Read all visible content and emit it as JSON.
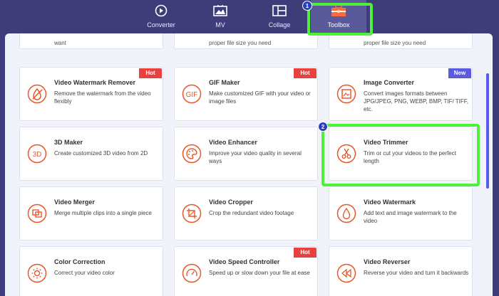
{
  "nav": {
    "tabs": [
      {
        "label": "Converter",
        "icon": "converter-icon"
      },
      {
        "label": "MV",
        "icon": "mv-icon"
      },
      {
        "label": "Collage",
        "icon": "collage-icon"
      },
      {
        "label": "Toolbox",
        "icon": "toolbox-icon"
      }
    ]
  },
  "colors": {
    "accent": "#e8572a",
    "hot": "#e8413e",
    "new": "#5b5be2",
    "highlight": "#4ef03a",
    "header": "#3e3d7a"
  },
  "partial_row": [
    "want",
    "proper file size you need",
    "proper file size you need"
  ],
  "cards": [
    {
      "title": "Video Watermark Remover",
      "desc": "Remove the watermark from the video flexibly",
      "badge": "Hot",
      "icon": "watermark-remove-icon"
    },
    {
      "title": "GIF Maker",
      "desc": "Make customized GIF with your video or image files",
      "badge": "Hot",
      "icon": "gif-icon"
    },
    {
      "title": "Image Converter",
      "desc": "Convert images formats between JPG/JPEG, PNG, WEBP, BMP, TIF/ TIFF, etc.",
      "badge": "New",
      "icon": "image-convert-icon"
    },
    {
      "title": "3D Maker",
      "desc": "Create customized 3D video from 2D",
      "badge": "",
      "icon": "3d-icon"
    },
    {
      "title": "Video Enhancer",
      "desc": "Improve your video quality in several ways",
      "badge": "",
      "icon": "palette-icon"
    },
    {
      "title": "Video Trimmer",
      "desc": "Trim or cut your videos to the perfect length",
      "badge": "",
      "icon": "scissors-icon"
    },
    {
      "title": "Video Merger",
      "desc": "Merge multiple clips into a single piece",
      "badge": "",
      "icon": "merge-icon"
    },
    {
      "title": "Video Cropper",
      "desc": "Crop the redundant video footage",
      "badge": "",
      "icon": "crop-icon"
    },
    {
      "title": "Video Watermark",
      "desc": "Add text and image watermark to the video",
      "badge": "",
      "icon": "droplet-icon"
    },
    {
      "title": "Color Correction",
      "desc": "Correct your video color",
      "badge": "",
      "icon": "sun-icon"
    },
    {
      "title": "Video Speed Controller",
      "desc": "Speed up or slow down your file at ease",
      "badge": "Hot",
      "icon": "speedometer-icon"
    },
    {
      "title": "Video Reverser",
      "desc": "Reverse your video and turn it backwards",
      "badge": "",
      "icon": "rewind-icon"
    }
  ],
  "step_markers": [
    "1",
    "2"
  ]
}
